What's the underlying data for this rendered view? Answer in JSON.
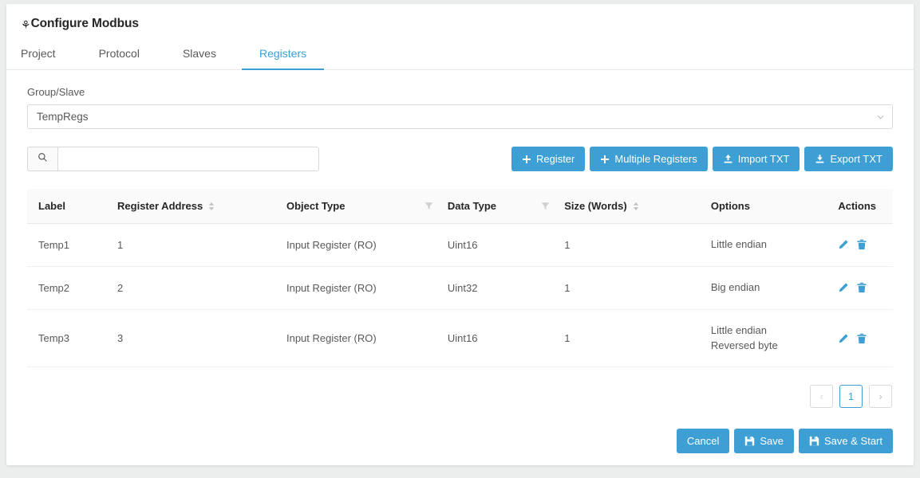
{
  "header": {
    "gear_icon": "gear-icon",
    "title": "Configure Modbus",
    "tabs": [
      {
        "label": "Project",
        "active": false
      },
      {
        "label": "Protocol",
        "active": false
      },
      {
        "label": "Slaves",
        "active": false
      },
      {
        "label": "Registers",
        "active": true
      }
    ]
  },
  "group_slave": {
    "label": "Group/Slave",
    "selected": "TempRegs",
    "chevron_icon": "chevron-down-icon"
  },
  "toolbar": {
    "search": {
      "icon": "search-icon",
      "value": "",
      "placeholder": ""
    },
    "buttons": [
      {
        "label": "Register",
        "icon": "plus-icon"
      },
      {
        "label": "Multiple Registers",
        "icon": "plus-icon"
      },
      {
        "label": "Import TXT",
        "icon": "upload-icon"
      },
      {
        "label": "Export TXT",
        "icon": "download-icon"
      }
    ]
  },
  "table": {
    "columns": [
      {
        "label": "Label",
        "sortable": false,
        "filterable": false
      },
      {
        "label": "Register Address",
        "sortable": true,
        "filterable": false
      },
      {
        "label": "Object Type",
        "sortable": false,
        "filterable": true
      },
      {
        "label": "Data Type",
        "sortable": false,
        "filterable": true
      },
      {
        "label": "Size (Words)",
        "sortable": true,
        "filterable": false
      },
      {
        "label": "Options",
        "sortable": false,
        "filterable": false
      },
      {
        "label": "Actions",
        "sortable": false,
        "filterable": false
      }
    ],
    "rows": [
      {
        "label": "Temp1",
        "register_address": "1",
        "object_type": "Input Register (RO)",
        "data_type": "Uint16",
        "size_words": "1",
        "options": [
          "Little endian"
        ]
      },
      {
        "label": "Temp2",
        "register_address": "2",
        "object_type": "Input Register (RO)",
        "data_type": "Uint32",
        "size_words": "1",
        "options": [
          "Big endian"
        ]
      },
      {
        "label": "Temp3",
        "register_address": "3",
        "object_type": "Input Register (RO)",
        "data_type": "Uint16",
        "size_words": "1",
        "options": [
          "Little endian",
          "Reversed byte"
        ]
      }
    ],
    "row_action_icons": [
      "edit-pencil-icon",
      "delete-trash-icon"
    ]
  },
  "pagination": {
    "prev_label": "‹",
    "next_label": "›",
    "pages": [
      "1"
    ],
    "current_page": "1"
  },
  "footer": {
    "cancel_label": "Cancel",
    "save_label": "Save",
    "save_start_label": "Save & Start",
    "save_icon": "floppy-disk-icon"
  },
  "colors": {
    "accent": "#3d9fd4",
    "page_background": "#eceded",
    "card_background": "#ffffff",
    "text_primary": "#262626",
    "text_secondary": "#595959",
    "border": "#d9d9d9"
  }
}
